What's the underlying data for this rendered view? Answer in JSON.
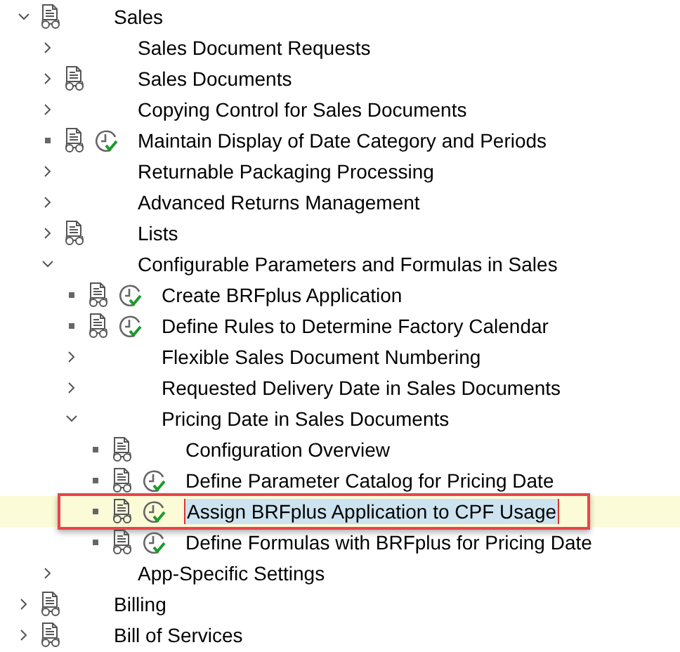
{
  "tree": [
    {
      "label": "Sales",
      "kind": "folder",
      "expanded": true,
      "doc": true,
      "activity": false,
      "selected": false,
      "children": [
        {
          "label": "Sales Document Requests",
          "kind": "folder",
          "expanded": false,
          "doc": false,
          "activity": false,
          "selected": false
        },
        {
          "label": "Sales Documents",
          "kind": "folder",
          "expanded": false,
          "doc": true,
          "activity": false,
          "selected": false
        },
        {
          "label": "Copying Control for Sales Documents",
          "kind": "folder",
          "expanded": false,
          "doc": false,
          "activity": false,
          "selected": false
        },
        {
          "label": "Maintain Display of Date Category and Periods",
          "kind": "leaf",
          "doc": true,
          "activity": true,
          "selected": false
        },
        {
          "label": "Returnable Packaging Processing",
          "kind": "folder",
          "expanded": false,
          "doc": false,
          "activity": false,
          "selected": false
        },
        {
          "label": "Advanced Returns Management",
          "kind": "folder",
          "expanded": false,
          "doc": false,
          "activity": false,
          "selected": false
        },
        {
          "label": "Lists",
          "kind": "folder",
          "expanded": false,
          "doc": true,
          "activity": false,
          "selected": false
        },
        {
          "label": "Configurable Parameters and Formulas in Sales",
          "kind": "folder",
          "expanded": true,
          "doc": false,
          "activity": false,
          "selected": false,
          "children": [
            {
              "label": "Create BRFplus Application",
              "kind": "leaf",
              "doc": true,
              "activity": true,
              "selected": false
            },
            {
              "label": "Define Rules to Determine Factory Calendar",
              "kind": "leaf",
              "doc": true,
              "activity": true,
              "selected": false
            },
            {
              "label": "Flexible Sales Document Numbering",
              "kind": "folder",
              "expanded": false,
              "doc": false,
              "activity": false,
              "selected": false
            },
            {
              "label": "Requested Delivery Date in Sales Documents",
              "kind": "folder",
              "expanded": false,
              "doc": false,
              "activity": false,
              "selected": false
            },
            {
              "label": "Pricing Date in Sales Documents",
              "kind": "folder",
              "expanded": true,
              "doc": false,
              "activity": false,
              "selected": false,
              "children": [
                {
                  "label": "Configuration Overview",
                  "kind": "leaf",
                  "doc": true,
                  "activity": false,
                  "selected": false
                },
                {
                  "label": "Define Parameter Catalog for Pricing Date",
                  "kind": "leaf",
                  "doc": true,
                  "activity": true,
                  "selected": false
                },
                {
                  "label": "Assign BRFplus Application to CPF Usage",
                  "kind": "leaf",
                  "doc": true,
                  "activity": true,
                  "selected": true
                },
                {
                  "label": "Define Formulas with BRFplus for Pricing Date",
                  "kind": "leaf",
                  "doc": true,
                  "activity": true,
                  "selected": false
                }
              ]
            }
          ]
        },
        {
          "label": "App-Specific Settings",
          "kind": "folder",
          "expanded": false,
          "doc": false,
          "activity": false,
          "selected": false
        }
      ]
    },
    {
      "label": "Billing",
      "kind": "folder",
      "expanded": false,
      "doc": true,
      "activity": false,
      "selected": false
    },
    {
      "label": "Bill of Services",
      "kind": "folder",
      "expanded": false,
      "doc": true,
      "activity": false,
      "selected": false
    }
  ]
}
